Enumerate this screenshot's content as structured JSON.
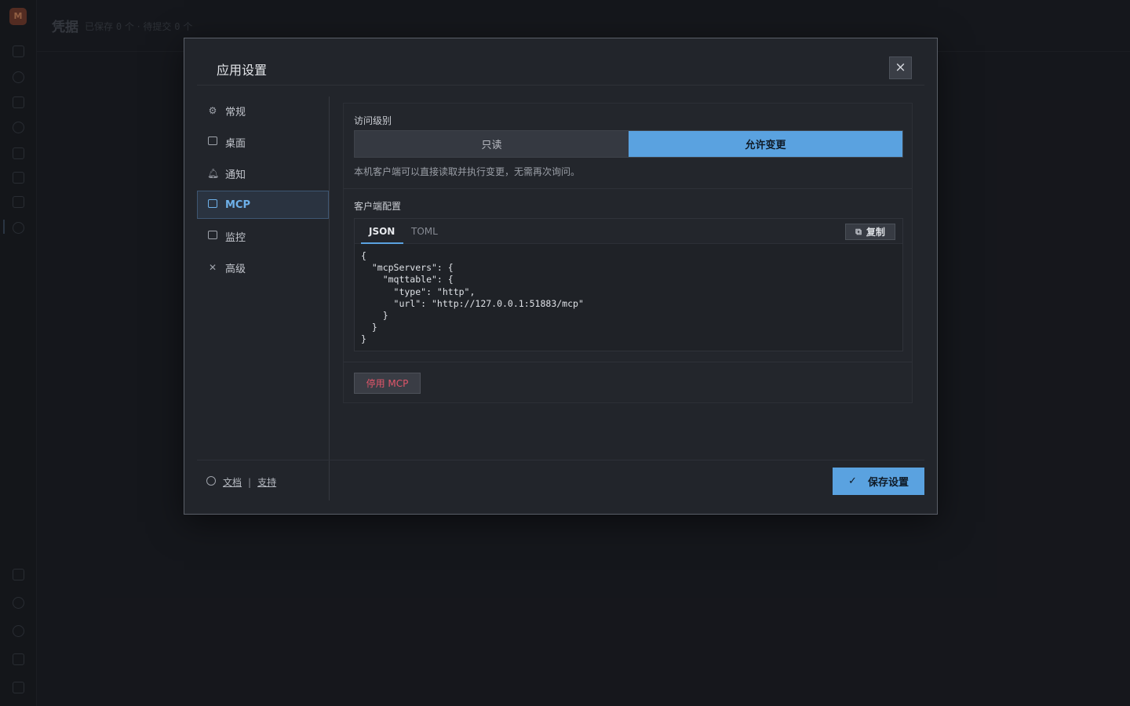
{
  "background": {
    "logo_text": "M",
    "title": "凭据",
    "saved_label": "已保存",
    "saved_count": "0",
    "unit": "个",
    "separator": "·",
    "pending_label": "待提交",
    "pending_count": "0"
  },
  "modal": {
    "title": "应用设置",
    "close_icon": "×"
  },
  "nav": [
    {
      "label": "常规",
      "icon": "gear-icon"
    },
    {
      "label": "桌面",
      "icon": "monitor-icon"
    },
    {
      "label": "通知",
      "icon": "bell-icon"
    },
    {
      "label": "MCP",
      "icon": "terminal-icon",
      "active": true
    },
    {
      "label": "监控",
      "icon": "chart-icon"
    },
    {
      "label": "高级",
      "icon": "tools-icon"
    }
  ],
  "access": {
    "label": "访问级别",
    "options": [
      "只读",
      "允许变更"
    ],
    "selected": "允许变更",
    "help": "本机客户端可以直接读取并执行变更，无需再次询问。"
  },
  "client_config": {
    "label": "客户端配置",
    "tabs": [
      "JSON",
      "TOML"
    ],
    "active_tab": "JSON",
    "copy_label": "复制",
    "code": "{\n  \"mcpServers\": {\n    \"mqttable\": {\n      \"type\": \"http\",\n      \"url\": \"http://127.0.0.1:51883/mcp\"\n    }\n  }\n}"
  },
  "disable_button": "停用 MCP",
  "footer": {
    "docs_label": "文档",
    "pipe": "|",
    "support_label": "支持",
    "save_label": "保存设置"
  },
  "colors": {
    "accent": "#5aa2e0",
    "danger": "#e0566a",
    "background": "#1b1d22",
    "modal": "#22252b"
  }
}
